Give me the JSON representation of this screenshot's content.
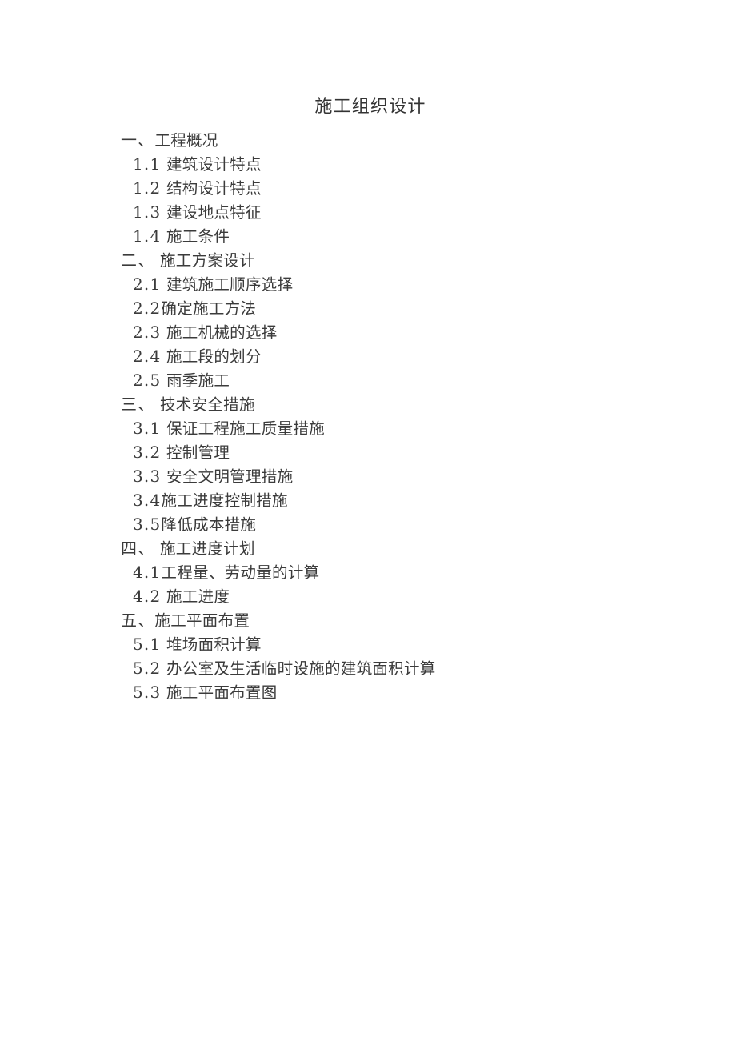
{
  "document": {
    "title": "施工组织设计",
    "title_text": "施工组织设计",
    "page_background": "#ffffff",
    "text_color": "#3b3b3b"
  },
  "toc": {
    "lines": [
      {
        "level": 1,
        "num": "一、",
        "gap": "",
        "label": "工程概况",
        "text": "一、工程概况"
      },
      {
        "level": 2,
        "num": "1.1",
        "gap": " ",
        "label": "建筑设计特点",
        "text": "1.1 建筑设计特点"
      },
      {
        "level": 2,
        "num": "1.2",
        "gap": " ",
        "label": "结构设计特点",
        "text": "1.2 结构设计特点"
      },
      {
        "level": 2,
        "num": "1.3",
        "gap": " ",
        "label": "建设地点特征",
        "text": "1.3 建设地点特征"
      },
      {
        "level": 2,
        "num": "1.4",
        "gap": " ",
        "label": "施工条件",
        "text": "1.4 施工条件"
      },
      {
        "level": 1,
        "num": "二、",
        "gap": " ",
        "label": "施工方案设计",
        "text": "二、 施工方案设计"
      },
      {
        "level": 2,
        "num": "2.1",
        "gap": " ",
        "label": "建筑施工顺序选择",
        "text": "2.1 建筑施工顺序选择"
      },
      {
        "level": 2,
        "num": "2.2",
        "gap": "",
        "label": "确定施工方法",
        "text": "2.2确定施工方法"
      },
      {
        "level": 2,
        "num": "2.3",
        "gap": " ",
        "label": "施工机械的选择",
        "text": "2.3 施工机械的选择"
      },
      {
        "level": 2,
        "num": "2.4",
        "gap": " ",
        "label": "施工段的划分",
        "text": "2.4 施工段的划分"
      },
      {
        "level": 2,
        "num": "2.5",
        "gap": " ",
        "label": "雨季施工",
        "text": "2.5 雨季施工"
      },
      {
        "level": 1,
        "num": "三、",
        "gap": " ",
        "label": "技术安全措施",
        "text": "三、 技术安全措施"
      },
      {
        "level": 2,
        "num": "3.1",
        "gap": " ",
        "label": "保证工程施工质量措施",
        "text": "3.1 保证工程施工质量措施"
      },
      {
        "level": 2,
        "num": "3.2",
        "gap": " ",
        "label": "控制管理",
        "text": "3.2 控制管理"
      },
      {
        "level": 2,
        "num": "3.3",
        "gap": " ",
        "label": "安全文明管理措施",
        "text": "3.3 安全文明管理措施"
      },
      {
        "level": 2,
        "num": "3.4",
        "gap": "",
        "label": "施工进度控制措施",
        "text": "3.4施工进度控制措施"
      },
      {
        "level": 2,
        "num": "3.5",
        "gap": "",
        "label": "降低成本措施",
        "text": "3.5降低成本措施"
      },
      {
        "level": 1,
        "num": "四、",
        "gap": " ",
        "label": "施工进度计划",
        "text": "四、 施工进度计划"
      },
      {
        "level": 2,
        "num": "4.1",
        "gap": "",
        "label": "工程量、劳动量的计算",
        "text": "4.1工程量、劳动量的计算"
      },
      {
        "level": 2,
        "num": "4.2",
        "gap": " ",
        "label": "施工进度",
        "text": "4.2 施工进度"
      },
      {
        "level": 1,
        "num": "五、",
        "gap": "",
        "label": "施工平面布置",
        "text": "五、施工平面布置"
      },
      {
        "level": 2,
        "num": "5.1",
        "gap": " ",
        "label": "堆场面积计算",
        "text": "5.1 堆场面积计算"
      },
      {
        "level": 2,
        "num": "5.2",
        "gap": " ",
        "label": "办公室及生活临时设施的建筑面积计算",
        "text": "5.2 办公室及生活临时设施的建筑面积计算"
      },
      {
        "level": 2,
        "num": "5.3",
        "gap": " ",
        "label": "施工平面布置图",
        "text": "5.3 施工平面布置图"
      }
    ]
  }
}
